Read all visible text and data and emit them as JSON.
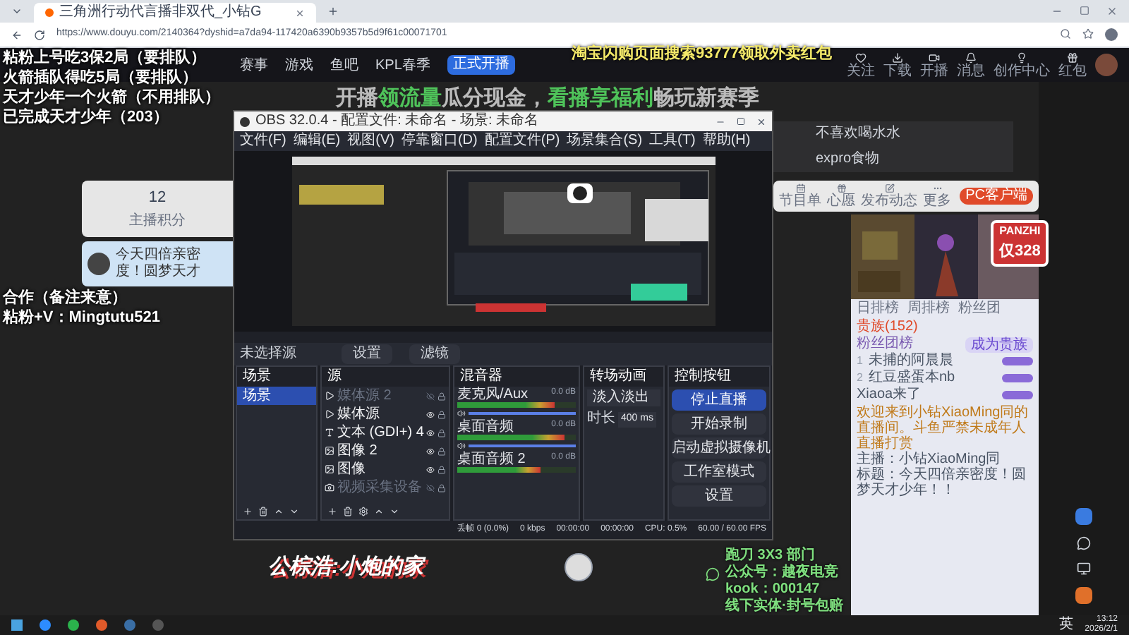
{
  "browser": {
    "tab_title": "三角洲行动代言播非双代_小钻G",
    "url": "https://www.douyu.com/2140364?dyshid=a7da94-117420a6390b9357b5d9f61c00071701"
  },
  "site_nav": {
    "items": [
      "赛事",
      "游戏",
      "鱼吧",
      "KPL春季"
    ],
    "live_button": "正式开播",
    "actions": [
      "关注",
      "下载",
      "开播",
      "消息",
      "创作中心",
      "红包"
    ]
  },
  "overlay": {
    "top_lines": [
      "粘粉上号吃3保2局（要排队）",
      "火箭插队得吃5局（要排队）",
      "天才少年一个火箭（不用排队）",
      "已完成天才少年（203）"
    ],
    "middle_lines": [
      "合作（备注来意）",
      "粘粉+V：Mingtutu521"
    ],
    "banner": [
      {
        "text": "开播",
        "highlight": false
      },
      {
        "text": "领流量",
        "highlight": true
      },
      {
        "text": "瓜分现金，",
        "highlight": false
      },
      {
        "text": "看播享福利",
        "highlight": true
      },
      {
        "text": "畅玩新赛季",
        "highlight": false
      }
    ],
    "promo": "淘宝闪购页面搜索93777领取外卖红包",
    "logo_text": "公棕浩:小炮的家",
    "contact_lines": [
      "跑刀 3X3 部门",
      "公众号：越夜电竞",
      "kook：000147",
      "线下实体·封号包赔"
    ]
  },
  "room_card": {
    "score": "12",
    "score_label": "主播积分",
    "title": "今天四倍亲密度！圆梦天才"
  },
  "dropdown": [
    "不喜欢喝水水",
    "expro食物"
  ],
  "obs": {
    "title": "OBS 32.0.4 - 配置文件: 未命名 - 场景: 未命名",
    "menu": [
      "文件(F)",
      "编辑(E)",
      "视图(V)",
      "停靠窗口(D)",
      "配置文件(P)",
      "场景集合(S)",
      "工具(T)",
      "帮助(H)"
    ],
    "no_source": "未选择源",
    "source_buttons": [
      "设置",
      "滤镜"
    ],
    "docks": [
      "场景",
      "源",
      "混音器",
      "转场动画",
      "控制按钮"
    ],
    "scenes": [
      {
        "name": "场景",
        "selected": true
      }
    ],
    "sources": [
      {
        "name": "媒体源 2",
        "kind": "media",
        "visible": false
      },
      {
        "name": "媒体源",
        "kind": "media",
        "visible": true
      },
      {
        "name": "文本 (GDI+) 4",
        "kind": "text",
        "visible": true
      },
      {
        "name": "图像 2",
        "visible": true
      },
      {
        "name": "图像",
        "visible": true
      },
      {
        "name": "视频采集设备",
        "kind": "camera",
        "visible": false
      }
    ],
    "mixer": [
      {
        "name": "麦克风/Aux",
        "reading": "0.0 dB",
        "meter": {
          "level": 0.82
        },
        "volume": {
          "level": 1
        }
      },
      {
        "name": "桌面音频",
        "reading": "0.0 dB",
        "meter": {
          "level": 0.9
        },
        "volume": {
          "level": 1
        }
      },
      {
        "name": "桌面音频 2",
        "reading": "0.0 dB",
        "meter": {
          "level": 0.7
        }
      }
    ],
    "transition": {
      "type": "淡入淡出",
      "duration_label": "时长",
      "duration": "400 ms"
    },
    "controls": [
      {
        "label": "停止直播",
        "active": true
      },
      {
        "label": "开始录制",
        "active": false
      },
      {
        "label": "启动虚拟摄像机",
        "active": false
      },
      {
        "label": "工作室模式",
        "active": false
      },
      {
        "label": "设置",
        "active": false
      }
    ],
    "status": [
      "丢帧 0 (0.0%)",
      "0 kbps",
      "00:00:00",
      "00:00:00",
      "CPU: 0.5%",
      "60.00 / 60.00 FPS"
    ]
  },
  "room_tools": {
    "items": [
      "节目单",
      "心愿",
      "发布动态",
      "更多"
    ],
    "client_button": "PC客户端"
  },
  "mascot": {
    "name": "PANZHI",
    "price": "仅328"
  },
  "chat": {
    "tabs": [
      {
        "label": "日排榜",
        "selected": false
      },
      {
        "label": "周排榜",
        "selected": false
      },
      {
        "label": "粉丝团",
        "selected": false
      },
      {
        "label": "贵族(152)",
        "selected": true
      }
    ],
    "join": "成为贵族",
    "board_title": "粉丝团榜",
    "rows": [
      {
        "rank": "1",
        "name": "未捕的阿晨晨"
      },
      {
        "rank": "2",
        "name": "红豆盛蛋本nb"
      },
      {
        "rank": "",
        "name": "Xiaoa来了"
      }
    ],
    "notice": "欢迎来到小钻XiaoMing同的直播间。斗鱼严禁未成年人直播打赏",
    "info": [
      "主播：小钻XiaoMing同",
      "标题：今天四倍亲密度！圆梦天才少年！！"
    ]
  },
  "taskbar": {
    "lang": "英",
    "time": "13:12",
    "date": "2026/2/1"
  }
}
